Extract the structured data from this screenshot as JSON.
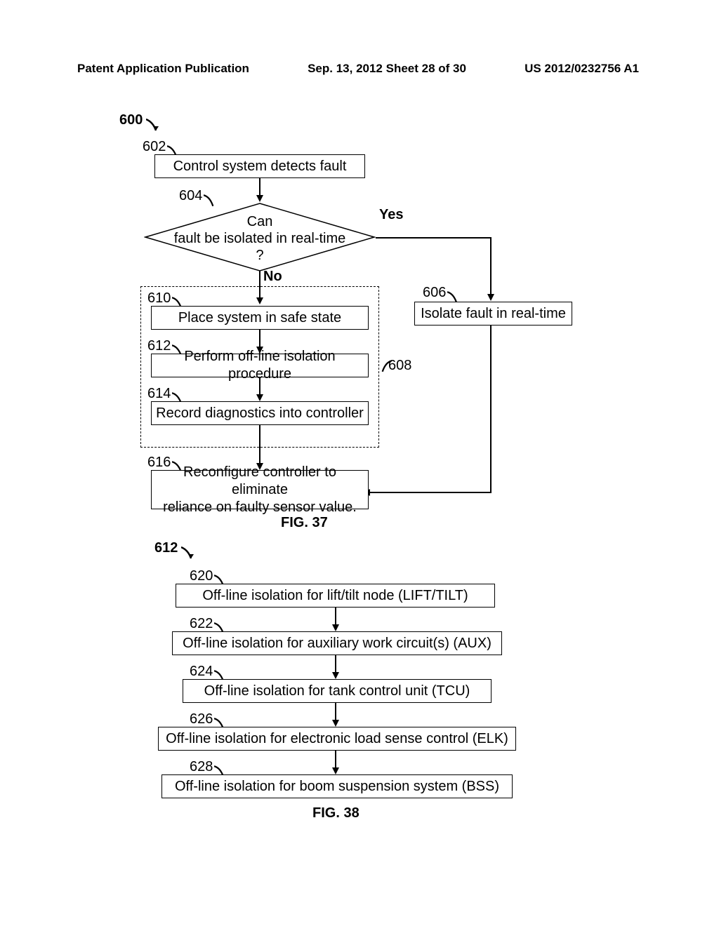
{
  "header": {
    "left": "Patent Application Publication",
    "mid": "Sep. 13, 2012  Sheet 28 of 30",
    "right": "US 2012/0232756 A1"
  },
  "fig37": {
    "ref600": "600",
    "ref602": "602",
    "box602": "Control system detects fault",
    "ref604": "604",
    "decision": "Can\nfault be isolated in real-time\n?",
    "yes": "Yes",
    "no": "No",
    "ref606": "606",
    "box606": "Isolate fault in real-time",
    "ref608": "608",
    "ref610": "610",
    "box610": "Place system in safe state",
    "ref612": "612",
    "box612": "Perform off-line isolation procedure",
    "ref614": "614",
    "box614": "Record diagnostics into controller",
    "ref616": "616",
    "box616": "Reconfigure controller to eliminate\nreliance on faulty sensor value.",
    "fig_label": "FIG. 37"
  },
  "fig38": {
    "ref612": "612",
    "ref620": "620",
    "box620": "Off-line isolation for lift/tilt node (LIFT/TILT)",
    "ref622": "622",
    "box622": "Off-line isolation for auxiliary work circuit(s) (AUX)",
    "ref624": "624",
    "box624": "Off-line isolation for tank control unit (TCU)",
    "ref626": "626",
    "box626": "Off-line isolation for electronic load sense control (ELK)",
    "ref628": "628",
    "box628": "Off-line isolation for boom suspension system (BSS)",
    "fig_label": "FIG. 38"
  }
}
